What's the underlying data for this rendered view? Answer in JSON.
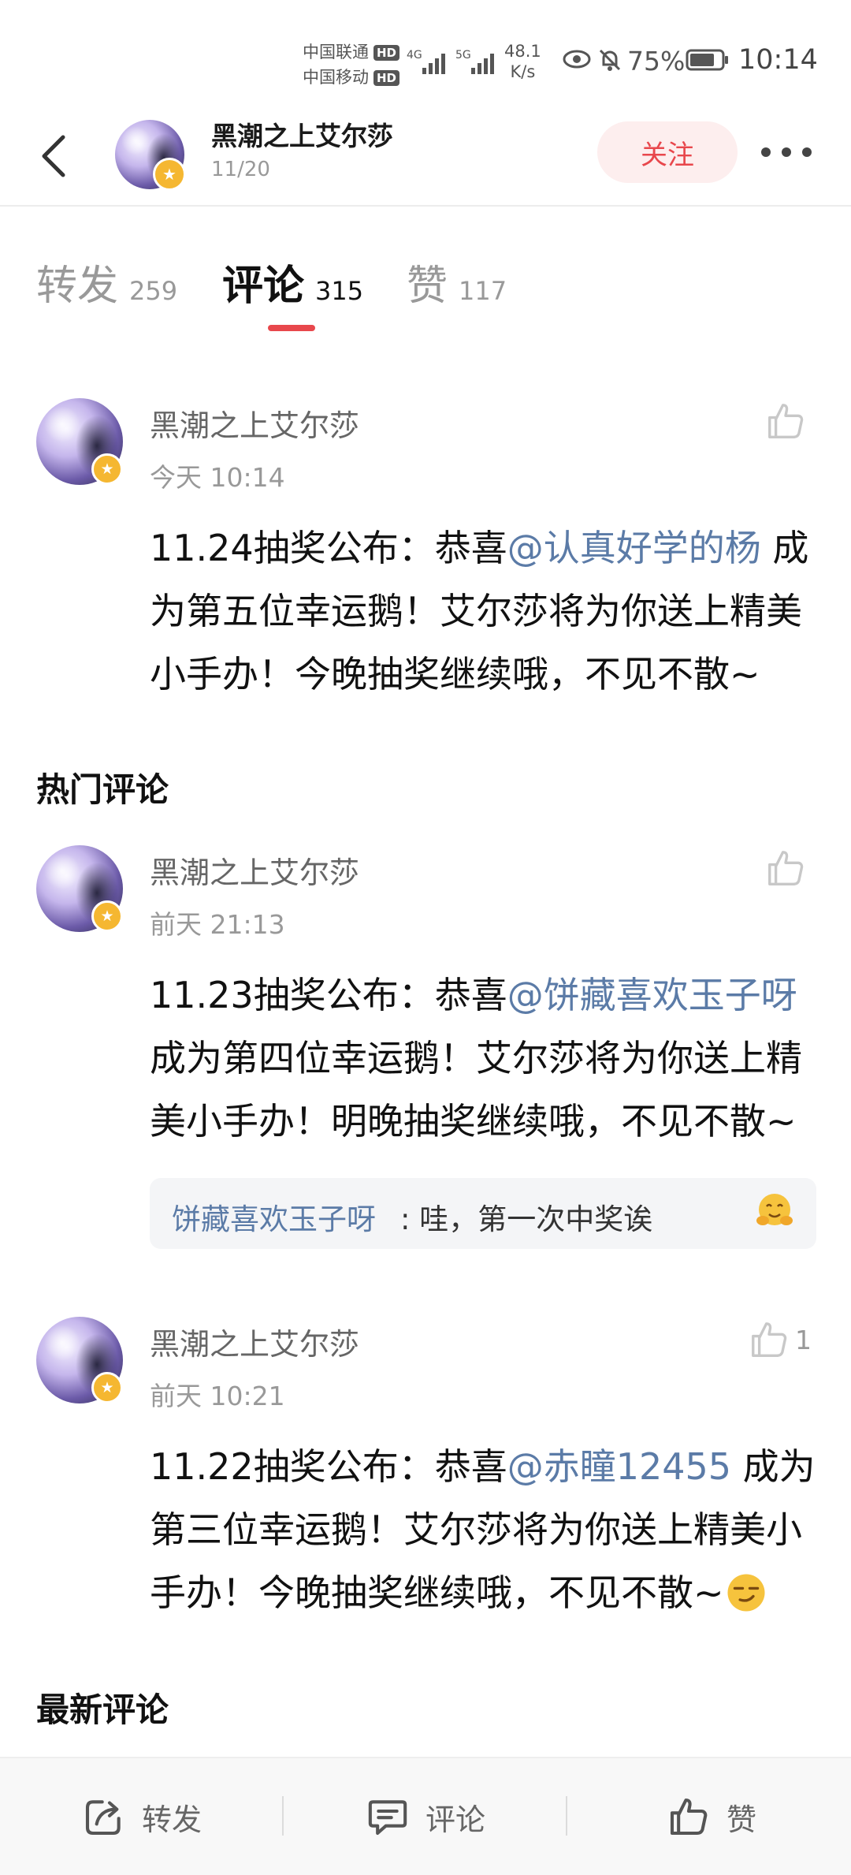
{
  "status_bar": {
    "carrier1": "中国联通",
    "carrier2": "中国移动",
    "hd": "HD",
    "net1": "4G",
    "net2": "5G",
    "speed_value": "48.1",
    "speed_unit": "K/s",
    "battery": "75%",
    "time": "10:14"
  },
  "header": {
    "back_icon": "chevron-left-icon",
    "author": "黑潮之上艾尔莎",
    "date": "11/20",
    "follow_label": "关注",
    "more_icon": "more-dots-icon"
  },
  "tabs": [
    {
      "label": "转发",
      "count": "259"
    },
    {
      "label": "评论",
      "count": "315",
      "active": true
    },
    {
      "label": "赞",
      "count": "117"
    }
  ],
  "pinned_comment": {
    "name": "黑潮之上艾尔莎",
    "time": "今天 10:14",
    "text_pre": "11.24抽奖公布：恭喜",
    "mention": "@认真好学的杨",
    "text_post": "成为第五位幸运鹅！艾尔莎将为你送上精美小手办！今晚抽奖继续哦，不见不散~",
    "likes": ""
  },
  "hot_section_title": "热门评论",
  "hot_comments": [
    {
      "name": "黑潮之上艾尔莎",
      "time": "前天 21:13",
      "text_pre": "11.23抽奖公布：恭喜",
      "mention": "@饼藏喜欢玉子呀",
      "text_post": "成为第四位幸运鹅！艾尔莎将为你送上精美小手办！明晚抽奖继续哦，不见不散~",
      "likes": "",
      "reply": {
        "name": "饼藏喜欢玉子呀",
        "text": ": 哇，第一次中奖诶",
        "emoji": "hug-emoji"
      }
    },
    {
      "name": "黑潮之上艾尔莎",
      "time": "前天 10:21",
      "text_pre": "11.22抽奖公布：恭喜",
      "mention": "@赤瞳12455",
      "text_post": "成为第三位幸运鹅！艾尔莎将为你送上精美小手办！今晚抽奖继续哦，不见不散~",
      "likes": "1",
      "emoji": "smirk-emoji"
    }
  ],
  "latest_section_title": "最新评论",
  "bottom_bar": {
    "repost_label": "转发",
    "comment_label": "评论",
    "like_label": "赞"
  },
  "colors": {
    "accent": "#e8474c",
    "mention": "#5b7ba7",
    "follow_bg": "#fdeeee"
  }
}
